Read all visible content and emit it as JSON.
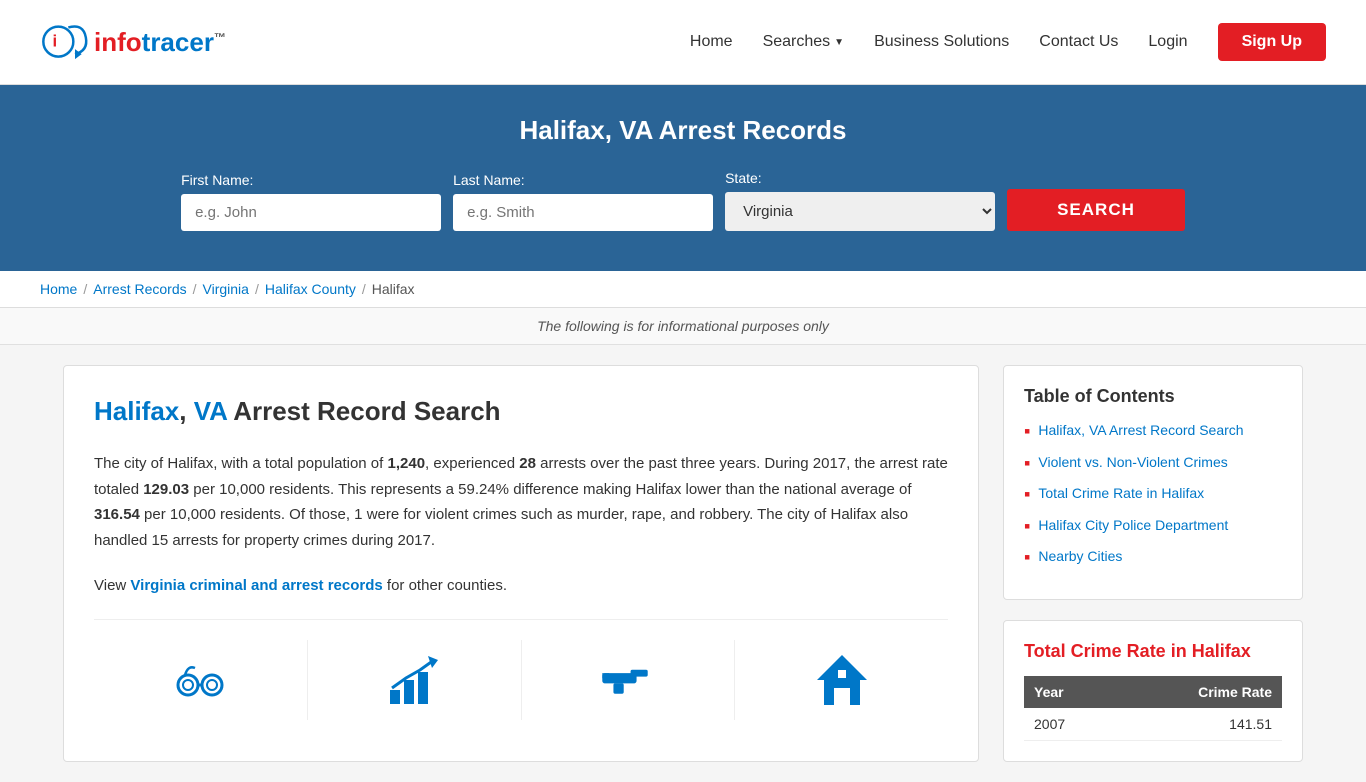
{
  "header": {
    "logo_text": "info tracer",
    "logo_tm": "™",
    "nav": {
      "home": "Home",
      "searches": "Searches",
      "business_solutions": "Business Solutions",
      "contact_us": "Contact Us",
      "login": "Login",
      "signup": "Sign Up"
    }
  },
  "hero": {
    "title": "Halifax, VA Arrest Records",
    "first_name_label": "First Name:",
    "first_name_placeholder": "e.g. John",
    "last_name_label": "Last Name:",
    "last_name_placeholder": "e.g. Smith",
    "state_label": "State:",
    "state_value": "Virginia",
    "search_button": "SEARCH"
  },
  "breadcrumb": {
    "items": [
      "Home",
      "Arrest Records",
      "Virginia",
      "Halifax County",
      "Halifax"
    ],
    "separator": "/"
  },
  "info_bar": {
    "text": "The following is for informational purposes only"
  },
  "article": {
    "title_blue1": "Halifax",
    "title_comma": ", ",
    "title_blue2": "VA",
    "title_rest": " Arrest Record Search",
    "body_p1": "The city of Halifax, with a total population of ",
    "population": "1,240",
    "body_p2": ", experienced ",
    "arrests": "28",
    "body_p3": " arrests over the past three years. During 2017, the arrest rate totaled ",
    "arrest_rate": "129.03",
    "body_p4": " per 10,000 residents. This represents a 59.24% difference making Halifax lower than the national average of ",
    "national_avg": "316.54",
    "body_p5": " per 10,000 residents. Of those, 1 were for violent crimes such as murder, rape, and robbery. The city of Halifax also handled 15 arrests for property crimes during 2017.",
    "link_text": "Virginia criminal and arrest records",
    "link_suffix": " for other counties."
  },
  "toc": {
    "title": "Table of Contents",
    "items": [
      "Halifax, VA Arrest Record Search",
      "Violent vs. Non-Violent Crimes",
      "Total Crime Rate in Halifax",
      "Halifax City Police Department",
      "Nearby Cities"
    ]
  },
  "crime_section": {
    "title": "Total Crime Rate in Halifax",
    "table": {
      "col_year": "Year",
      "col_crime_rate": "Crime Rate",
      "rows": [
        {
          "year": "2007",
          "rate": "141.51"
        }
      ]
    }
  }
}
